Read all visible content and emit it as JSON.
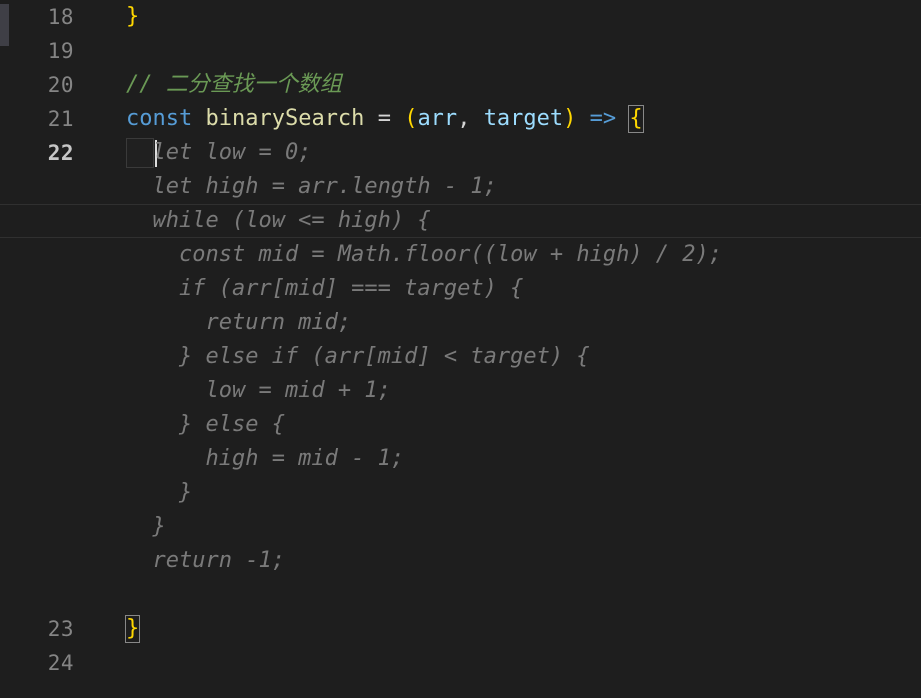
{
  "editor": {
    "theme_name": "dark-plus",
    "background_color": "#1e1e1e",
    "gutter_color": "#858585",
    "active_gutter_color": "#c6c6c6",
    "ghost_text_color": "#7a7a7a",
    "caret_color": "#dcdcdc",
    "scrollbar_thumb_color": "#3f3f46",
    "active_line": 22,
    "cursor": {
      "line": 22,
      "column": 3
    }
  },
  "gutter": {
    "line_18": "18",
    "line_19": "19",
    "line_20": "20",
    "line_21": "21",
    "line_22": "22",
    "line_23": "23",
    "line_24": "24"
  },
  "code": {
    "line18": {
      "indent": "",
      "brace": "}"
    },
    "line19": {
      "text": ""
    },
    "line20": {
      "comment": "// 二分查找一个数组"
    },
    "line21": {
      "keyword": "const",
      "space1": " ",
      "func_name": "binarySearch",
      "space2": " ",
      "equals": "=",
      "space3": " ",
      "open_paren": "(",
      "param1": "arr",
      "comma": ",",
      "space4": " ",
      "param2": "target",
      "close_paren": ")",
      "space5": " ",
      "arrow": "=>",
      "space6": " ",
      "open_brace": "{"
    },
    "line23": {
      "close_brace": "}"
    },
    "line24": {
      "text": ""
    }
  },
  "ghost_suggestion": {
    "description": "inline-completion-ghost-text",
    "lines": [
      "  let low = 0;",
      "  let high = arr.length - 1;",
      "  while (low <= high) {",
      "    const mid = Math.floor((low + high) / 2);",
      "    if (arr[mid] === target) {",
      "      return mid;",
      "    } else if (arr[mid] < target) {",
      "      low = mid + 1;",
      "    } else {",
      "      high = mid - 1;",
      "    }",
      "  }",
      "  return -1;"
    ]
  },
  "syntax_colors": {
    "keyword": "#569cd6",
    "function": "#dcdcaa",
    "parameter": "#9cdcfe",
    "bracket_yellow": "#ffd700",
    "comment": "#6a9955",
    "plain": "#d4d4d4"
  }
}
